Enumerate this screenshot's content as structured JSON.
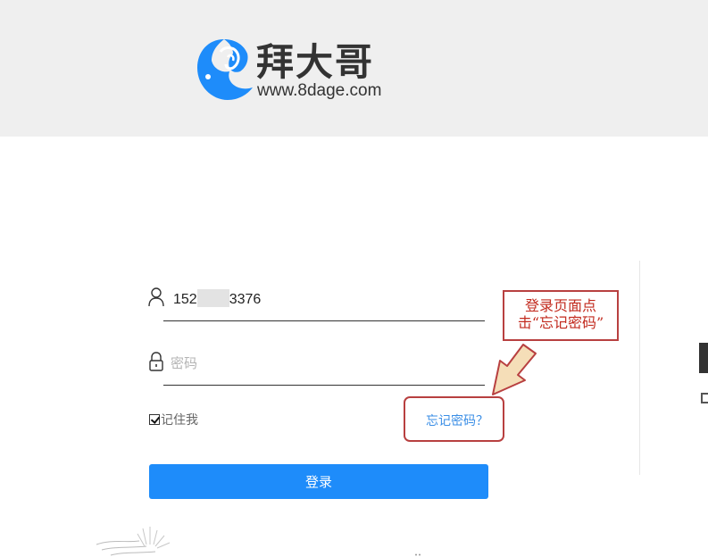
{
  "header": {
    "brand_title": "拜大哥",
    "brand_url": "www.8dage.com"
  },
  "form": {
    "username_prefix": "152",
    "username_suffix": "3376",
    "password_placeholder": "密码",
    "remember_label": "记住我",
    "remember_checked": true,
    "forgot_label": "忘记密码？",
    "login_label": "登录"
  },
  "annotation": {
    "callout_line1": "登录页面点",
    "callout_line2": "击“忘记密码”"
  },
  "icons": {
    "user": "user-icon",
    "lock": "lock-icon",
    "logo": "elephant-logo-icon",
    "arrow": "arrow-down-left-icon"
  },
  "colors": {
    "header_bg": "#efefef",
    "primary": "#1e8cfa",
    "link": "#3a8ee6",
    "annotation": "#b84040",
    "annotation_text": "#c22a1e"
  }
}
